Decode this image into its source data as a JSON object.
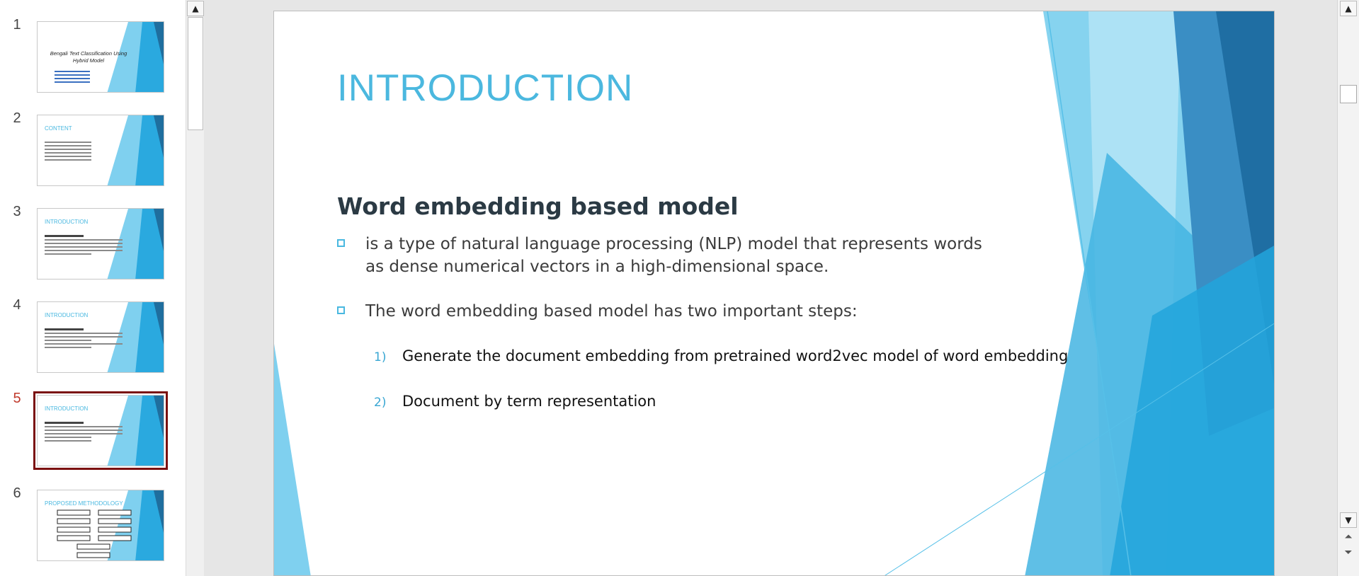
{
  "thumbnails": [
    {
      "number": "1",
      "title": "Bengali Text Classification Using Hybrid Model",
      "subtitle_lines": 4
    },
    {
      "number": "2",
      "title": "CONTENT"
    },
    {
      "number": "3",
      "title": "INTRODUCTION"
    },
    {
      "number": "4",
      "title": "INTRODUCTION"
    },
    {
      "number": "5",
      "title": "INTRODUCTION",
      "selected": true
    },
    {
      "number": "6",
      "title": "PROPOSED METHODOLOGY"
    }
  ],
  "slide": {
    "title": "INTRODUCTION",
    "heading": "Word embedding based model",
    "bullets": [
      "is a type of natural language processing (NLP) model that represents words as dense numerical vectors in a high-dimensional space.",
      "The word embedding based model has two important steps:"
    ],
    "steps": [
      {
        "number": "1)",
        "text": "Generate the document embedding from pretrained word2vec model of word embedding"
      },
      {
        "number": "2)",
        "text": "Document by term representation"
      }
    ]
  },
  "colors": {
    "accent": "#4bb8df",
    "heading": "#2b3a44",
    "selection": "#7a1010",
    "active_number": "#c0392b"
  },
  "icons": {
    "scroll_up": "▲",
    "scroll_down": "▼",
    "prev_page": "⏶",
    "next_page": "⏷"
  }
}
